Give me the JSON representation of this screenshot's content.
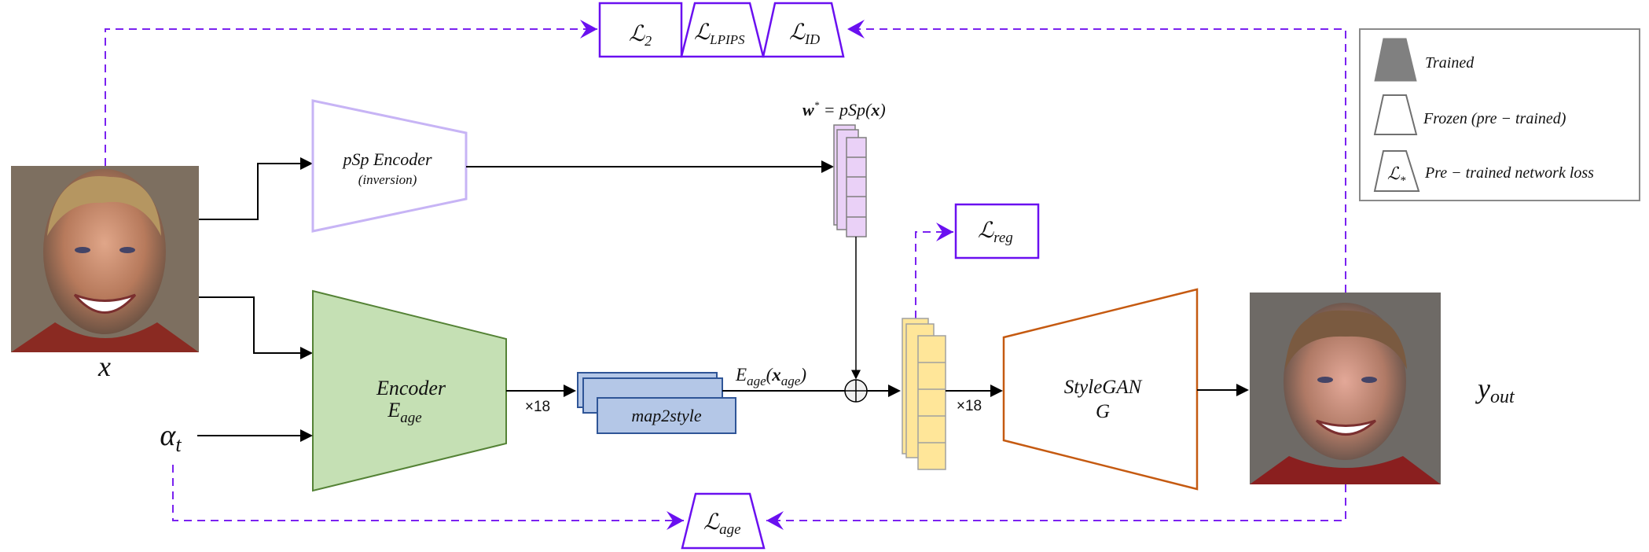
{
  "inputs": {
    "x_label": "x",
    "alpha_label": "α",
    "alpha_sub": "t"
  },
  "psp_encoder": {
    "title": "pSp  Encoder",
    "subtitle": "(inversion)"
  },
  "w_star": {
    "w": "w",
    "star": "*",
    "eq": " = pSp(",
    "x": "x",
    "close": ")"
  },
  "encoder_age": {
    "title": "Encoder",
    "symbol": "E",
    "sub": "age"
  },
  "map2style": {
    "label": "map2style",
    "multiplier": "×18"
  },
  "e_age_output": {
    "E": "E",
    "sub": "age",
    "open": "(",
    "x": "x",
    "xsub": "age",
    "close": ")"
  },
  "stylegan": {
    "title": "StyleGAN",
    "symbol": "G",
    "multiplier": "×18"
  },
  "output": {
    "y": "y",
    "sub": "out"
  },
  "losses": {
    "l2": {
      "symbol": "ℒ",
      "sub": "2"
    },
    "lpips": {
      "symbol": "ℒ",
      "sub": "LPIPS"
    },
    "id": {
      "symbol": "ℒ",
      "sub": "ID"
    },
    "reg": {
      "symbol": "ℒ",
      "sub": "reg"
    },
    "age": {
      "symbol": "ℒ",
      "sub": "age"
    }
  },
  "legend": {
    "trained": "Trained",
    "frozen": "Frozen (pre − trained)",
    "loss_symbol": "ℒ",
    "loss_sub": "*",
    "loss": "Pre − trained network loss"
  },
  "colors": {
    "loss_purple": "#6a10f0",
    "psp": "#c7b4f5",
    "encoder_fill": "#c5e0b4",
    "encoder_stroke": "#548235",
    "map2style_fill": "#b4c7e7",
    "map2style_stroke": "#2f5597",
    "latent_purple": "#ead1f7",
    "latent_yellow": "#ffe699",
    "stylegan_stroke": "#c55a11",
    "trained_gray": "#808080"
  }
}
